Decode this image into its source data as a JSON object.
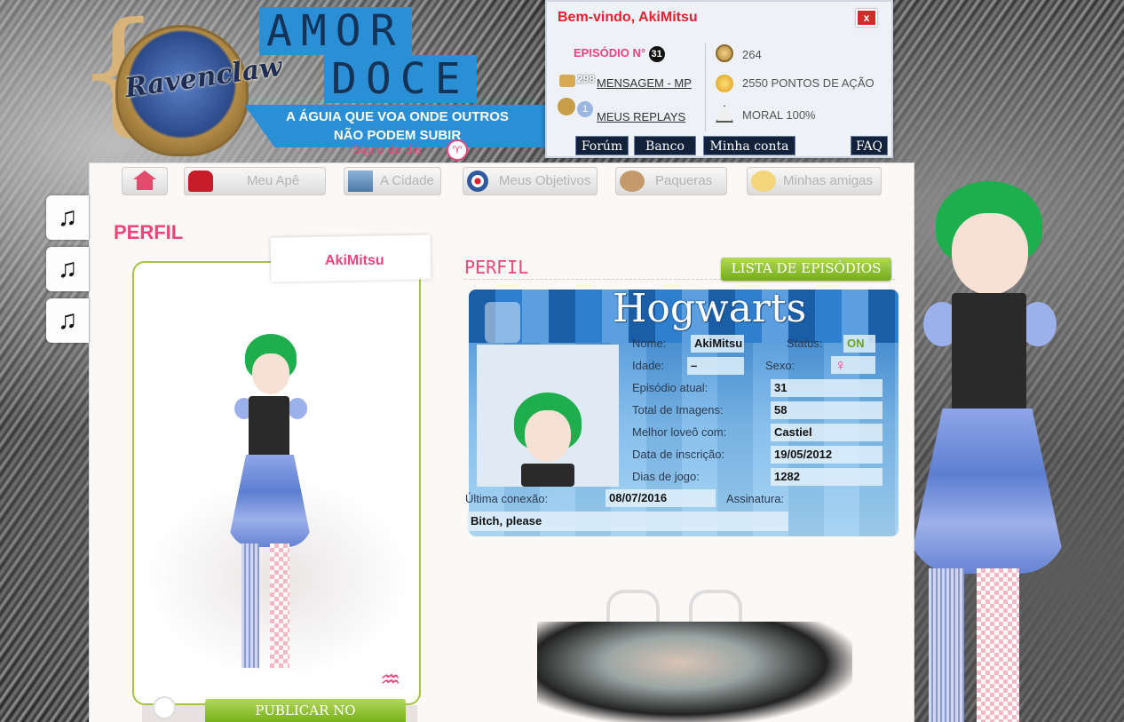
{
  "header": {
    "logo_crest": "Ravenclaw",
    "logo_title_1": "AMOR",
    "logo_title_2": "DOCE",
    "slogan_1": "A ÁGUIA QUE VOA ONDE OUTROS",
    "slogan_2": "NÃO PODEM SUBIR",
    "signo_label": "Signo do dia",
    "signo_symbol": "♈"
  },
  "welcome": {
    "title": "Bem-vindo, AkiMitsu",
    "close_label": "x",
    "episode_label": "EPISÓDIO N°",
    "episode_number": "31",
    "messages_count": "298",
    "messages_link": "MENSAGEM - MP",
    "replays_count": "1",
    "replays_link": "MEUS REPLAYS",
    "coins": "264",
    "action_points": "2550 PONTOS DE AÇÃO",
    "moral": "MORAL 100%",
    "buttons": {
      "forum": "Forúm",
      "bank": "Banco",
      "account": "Minha conta",
      "faq": "FAQ"
    }
  },
  "nav": {
    "home": "",
    "ape": "Meu Apê",
    "city": "A Cidade",
    "objectives": "Meus Objetivos",
    "crushes": "Paqueras",
    "friends": "Minhas amigas"
  },
  "music_buttons": [
    "♫",
    "♫",
    "♫"
  ],
  "page_title": "PERFIL",
  "card": {
    "name": "AkiMitsu",
    "sign_glyph": "♒",
    "publish_label": "PUBLICAR NO"
  },
  "profile": {
    "section_title": "PERFIL",
    "episodes_button": "LISTA DE EPISÓDIOS",
    "banner_title": "Hogwarts",
    "labels": {
      "name": "Nome:",
      "status": "Status:",
      "age": "Idade:",
      "sex": "Sexo:",
      "episode": "Episódio atual:",
      "images": "Total de Imagens:",
      "best": "Melhor loveô com:",
      "inscription": "Data de inscrição:",
      "days": "Dias de jogo:",
      "last": "Última conexão:",
      "signature": "Assinatura:"
    },
    "values": {
      "name": "AkiMitsu",
      "status": "ON",
      "age": "–",
      "sex": "♀",
      "episode": "31",
      "images": "58",
      "best": "Castiel",
      "inscription": "19/05/2012",
      "days": "1282",
      "last": "08/07/2016",
      "signature": "Bitch, please"
    }
  },
  "colors": {
    "accent_pink": "#e8467d",
    "accent_green": "#8fc33a",
    "status_on": "#6da321",
    "welcome_red": "#e8202f"
  }
}
